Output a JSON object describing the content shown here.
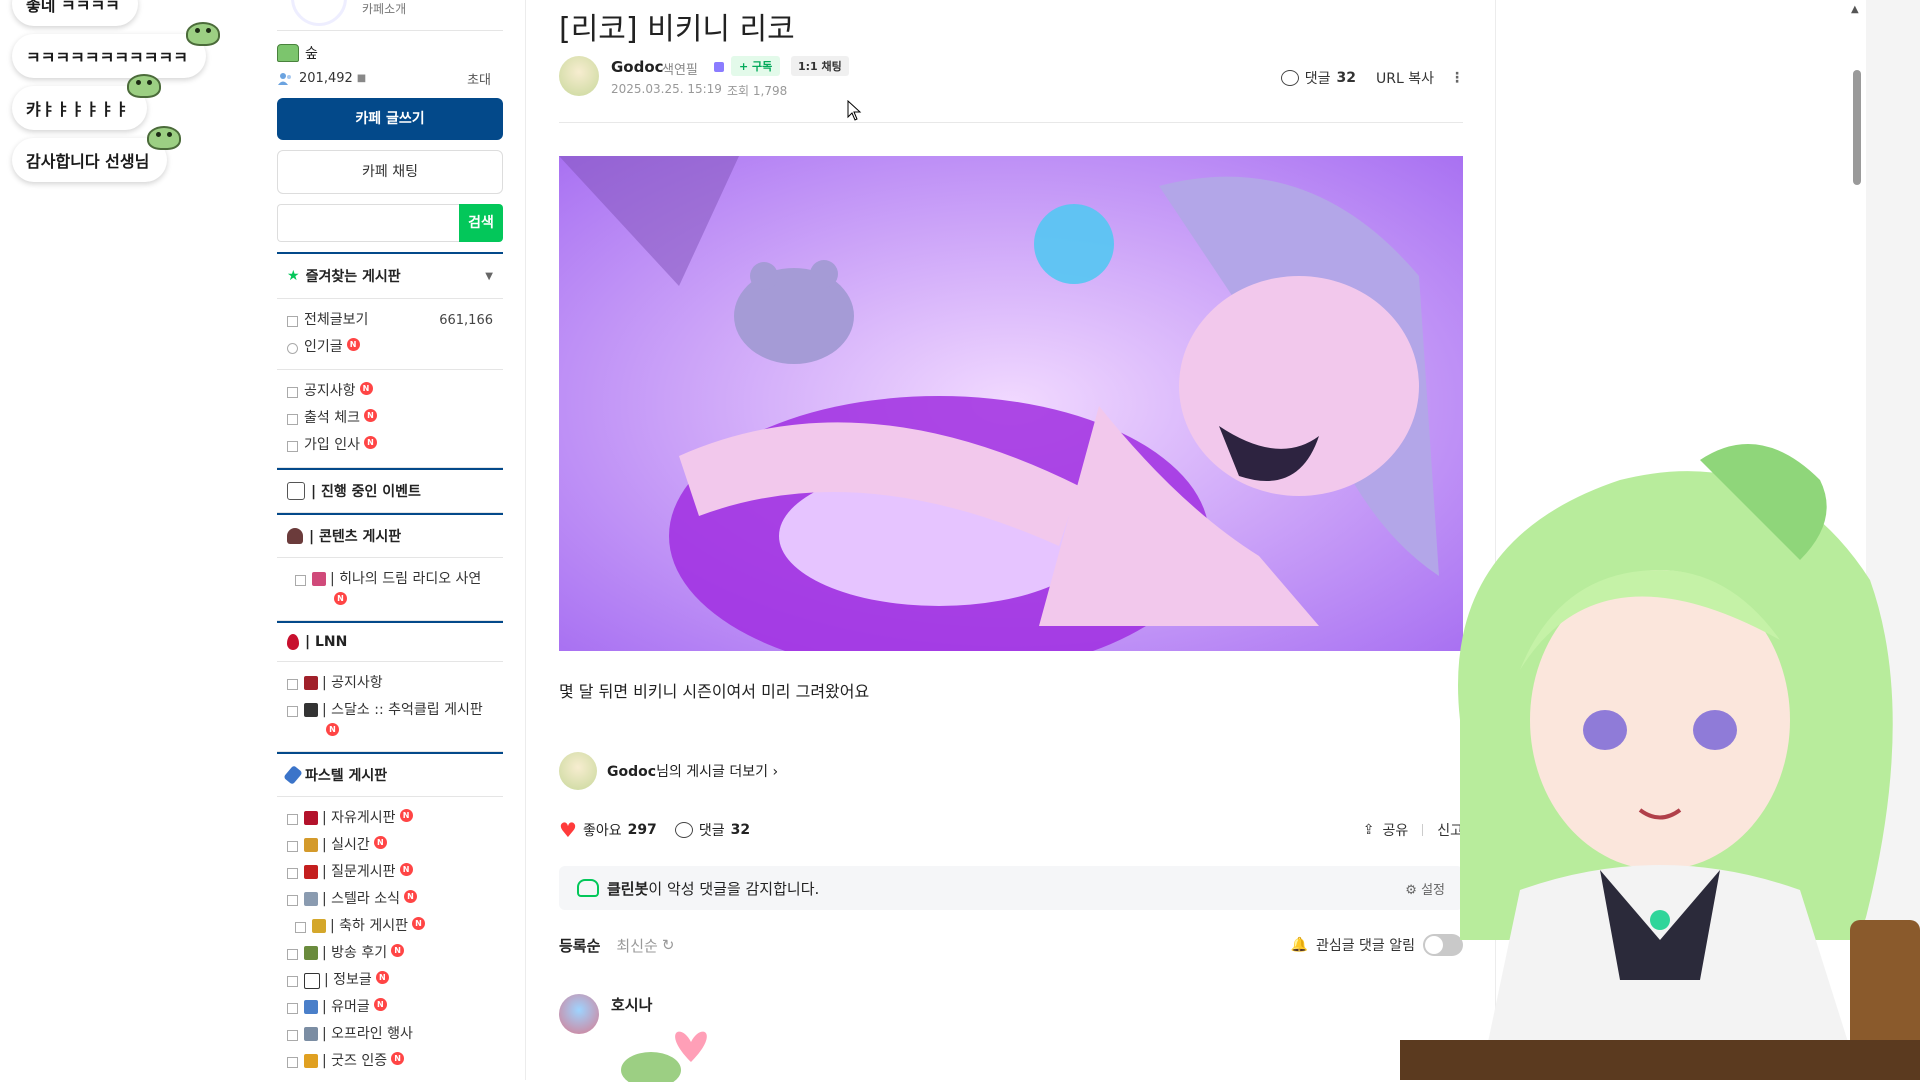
{
  "chat_overlay": {
    "messages": [
      "좋네 ㅋㅋㅋㅋ",
      "ㅋㅋㅋㅋㅋㅋㅋㅋㅋㅋㅋ",
      "캬ㅑㅑㅑㅑㅑㅑ",
      "감사합니다 선생님"
    ]
  },
  "sidebar": {
    "intro_label": "카페소개",
    "grade_label": "숲",
    "member_count": "201,492",
    "invite_label": "초대",
    "write_button": "카페 글쓰기",
    "chat_button": "카페 채팅",
    "search_placeholder": "",
    "search_button": "검색",
    "favorites_label": "즐겨찾는 게시판",
    "group1": [
      {
        "label": "전체글보기",
        "count": "661,166"
      },
      {
        "label": "인기글",
        "badge": "N"
      }
    ],
    "group2": [
      {
        "label": "공지사항",
        "badge": "N"
      },
      {
        "label": "출석 체크",
        "badge": "N"
      },
      {
        "label": "가입 인사",
        "badge": "N"
      }
    ],
    "event_header": "| 진행 중인 이벤트",
    "contents_header": "| 콘텐츠 게시판",
    "contents_items": [
      {
        "label": "| 히나의 드림 라디오 사연",
        "badge": "N"
      }
    ],
    "lnn_header": "| LNN",
    "lnn_items": [
      {
        "label": "| 공지사항"
      },
      {
        "label": "| 스달소 :: 추억클립 게시판",
        "badge": "N"
      }
    ],
    "pastel_header": "파스텔 게시판",
    "pastel_items": [
      {
        "label": "| 자유게시판",
        "badge": "N"
      },
      {
        "label": "| 실시간",
        "badge": "N"
      },
      {
        "label": "| 질문게시판",
        "badge": "N"
      },
      {
        "label": "| 스텔라 소식",
        "badge": "N"
      },
      {
        "label": "| 축하 게시판",
        "badge": "N"
      },
      {
        "label": "| 방송 후기",
        "badge": "N"
      },
      {
        "label": "| 정보글",
        "badge": "N"
      },
      {
        "label": "| 유머글",
        "badge": "N"
      },
      {
        "label": "| 오프라인 행사"
      },
      {
        "label": "| 굿즈 인증",
        "badge": "N"
      }
    ]
  },
  "article": {
    "title": "[리코] 비키니 리코",
    "author": "Godoc",
    "author_grade": "색연필",
    "subscribe": "+ 구독",
    "chat_11": "1:1 채팅",
    "date": "2025.03.25. 15:19",
    "views": "조회 1,798",
    "comments_label": "댓글",
    "comments_count": "32",
    "url_copy": "URL 복사",
    "body": "몇 달 뒤면 비키니 시즌이여서 미리 그려왔어요",
    "more_posts_author": "Godoc",
    "more_posts_suffix": "님의 게시글 더보기",
    "likes_label": "좋아요",
    "likes_count": "297",
    "share_label": "공유",
    "report_label": "신고",
    "cleanbot_name": "클린봇",
    "cleanbot_text": "이 악성 댓글을 감지합니다.",
    "cleanbot_settings": "설정",
    "sort_registered": "등록순",
    "sort_latest": "최신순",
    "notify_label": "관심글 댓글 알림",
    "first_commenter": "호시나"
  },
  "colors": {
    "primary_blue": "#03498a",
    "naver_green": "#03c75a",
    "badge_red": "#ff4545",
    "heart": "#ff3b3b"
  }
}
